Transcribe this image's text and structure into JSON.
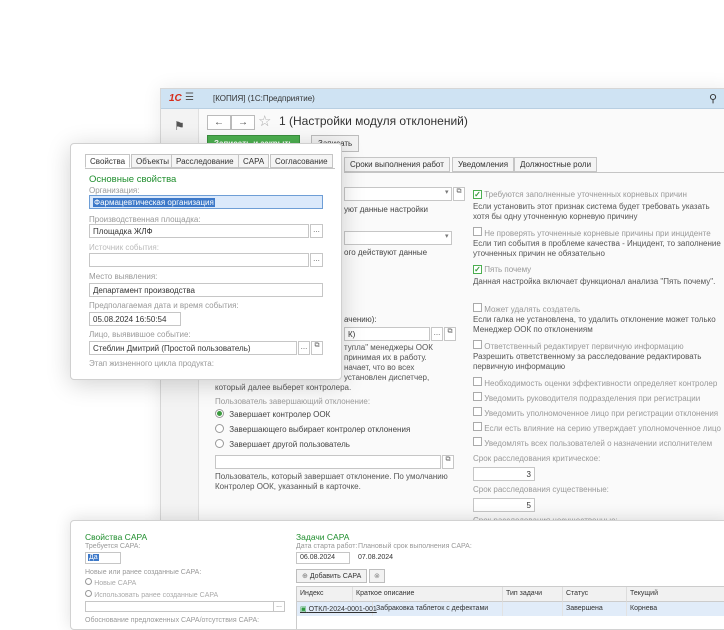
{
  "app": {
    "title_bar": "[КОПИЯ]   (1С:Предприятие)",
    "logo": "1С",
    "window_title": "1 (Настройки модуля отклонений)"
  },
  "toolbar": {
    "save_close_label": "Записать и закрыть",
    "save_label": "Записать"
  },
  "main_tabs": [
    "Сроки выполнения работ",
    "Уведомления",
    "Должностные роли"
  ],
  "left_column": {
    "settings_note_1": "уют данные настройки",
    "settings_note_2": "ого действуют данные",
    "responsible_label_tail": "ачению):",
    "responsible_value": "К)",
    "paragraph": [
      "тупла\" менеджеры ООК",
      "принимая их в работу.",
      "начает, что во всех",
      "установлен диспетчер,",
      "который далее выберет контролера."
    ],
    "closing_user_label": "Пользователь завершающий отклонение:",
    "radio_options": [
      "Завершает контролер ООК",
      "Завершающего выбирает контролер отклонения",
      "Завершает другой пользователь"
    ],
    "closing_note": "Пользователь, который завершает отклонение. По умолчанию Контролер ООК, указанный в карточке."
  },
  "right_column": {
    "options": [
      {
        "label": "Требуются заполненные уточненных корневых причин",
        "checked": true
      },
      {
        "label": "Не проверять уточненные корневые причины при инциденте",
        "checked": false
      },
      {
        "label": "Пять почему",
        "checked": true
      },
      {
        "label": "Может удалять создатель",
        "checked": false
      },
      {
        "label": "Ответственный редактирует первичную информацию",
        "checked": false
      },
      {
        "label": "Необходимость оценки эффективности определяет контролер",
        "checked": false
      },
      {
        "label": "Уведомить руководителя подразделения при регистрации",
        "checked": false
      },
      {
        "label": "Уведомить уполномоченное лицо при регистрации отклонения",
        "checked": false
      },
      {
        "label": "Если есть влияние на серию утверждает уполномоченное лицо",
        "checked": false
      },
      {
        "label": "Уведомлять всех пользователей о назначении исполнителем",
        "checked": false
      }
    ],
    "note_root_causes": "Если установить этот признак система будет требовать указать хотя бы одну уточненную корневую причину",
    "note_incident": "Если тип события в проблеме качества - Инцидент, то заполнение уточненных причин не обязательно",
    "note_five_whys": "Данная настройка включает функционал анализа \"Пять почему\".",
    "note_delete": "Если галка не установлена, то удалить отклонение  может только Менеджер ООК по отклонениям",
    "note_responsible": "Разрешить ответственному за расследование редактировать первичную информацию",
    "critical_term_label": "Срок расследования критическое:",
    "critical_term_value": "3",
    "significant_term_label": "Срок расследования существенные:",
    "significant_term_value": "5",
    "minor_term_label": "Срок расследования несущественные:"
  },
  "props_panel": {
    "tabs": [
      "Свойства",
      "Объекты",
      "Расследование",
      "CAPA",
      "Согласование"
    ],
    "heading": "Основные свойства",
    "organization_label": "Организация:",
    "organization_value": "Фармацевтическая организация",
    "site_label": "Производственная площадка:",
    "site_value": "Площадка ЖЛФ",
    "source_label": "Источник события:",
    "source_value": "",
    "location_label": "Место выявления:",
    "location_value": "Департамент производства",
    "datetime_label": "Предполагаемая дата и время события:",
    "datetime_value": "05.08.2024 16:50:54",
    "person_label": "Лицо, выявившое событие:",
    "person_value": "Стеблин Дмитрий (Простой пользователь)",
    "lifecycle_label": "Этап жизненного цикла продукта:"
  },
  "capa_panel": {
    "left_title": "Свойства CAPA",
    "required_label": "Требуется CAPA:",
    "required_value": "Да",
    "new_or_existing_label": "Новые или ранее созданные CAPA:",
    "opt_new": "Новые CAPA",
    "opt_existing": "Использовать ранее созданные CAPA",
    "justification_label": "Обоснование предложенных CAPA/отсутствия CAPA:",
    "right_title": "Задачи  CAPA",
    "start_label": "Дата старта работ:",
    "start_value": "06.08.2024",
    "planned_label": "Плановый срок выполнения CAPA:",
    "planned_value": "07.08.2024",
    "add_button": "Добавить CAPA",
    "columns": [
      "Индекс",
      "Краткое описание",
      "Тип задачи",
      "Статус",
      "Текущий"
    ],
    "rows": [
      {
        "index": "ОТКЛ-2024-0001-001",
        "description": "Забраковка таблеток с дефектами",
        "type": "",
        "status": "Завершена",
        "current": "Корнева"
      }
    ]
  }
}
